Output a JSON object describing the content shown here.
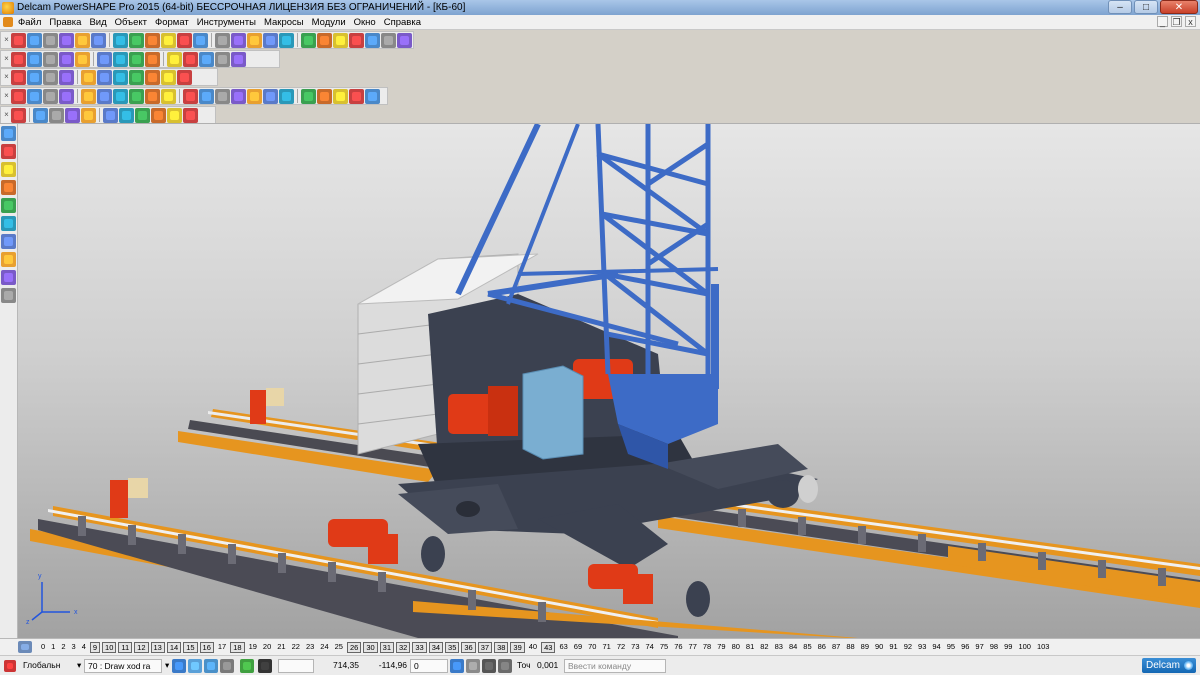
{
  "window": {
    "title": "Delcam PowerSHAPE Pro 2015 (64-bit) БЕССРОЧНАЯ ЛИЦЕНЗИЯ БЕЗ ОГРАНИЧЕНИЙ - [КБ-60]",
    "min": "–",
    "max": "□",
    "close": "✕"
  },
  "menu": [
    "Файл",
    "Правка",
    "Вид",
    "Объект",
    "Формат",
    "Инструменты",
    "Макросы",
    "Модули",
    "Окно",
    "Справка"
  ],
  "mdi": {
    "min": "_",
    "restore": "❐",
    "close": "x"
  },
  "levels": [
    "0",
    "1",
    "2",
    "3",
    "4",
    "9",
    "10",
    "11",
    "12",
    "13",
    "14",
    "15",
    "16",
    "17",
    "18",
    "19",
    "20",
    "21",
    "22",
    "23",
    "24",
    "25",
    "26",
    "30",
    "31",
    "32",
    "33",
    "34",
    "35",
    "36",
    "37",
    "38",
    "39",
    "40",
    "43",
    "63",
    "69",
    "70",
    "71",
    "72",
    "73",
    "74",
    "75",
    "76",
    "77",
    "78",
    "79",
    "80",
    "81",
    "82",
    "83",
    "84",
    "85",
    "86",
    "87",
    "88",
    "89",
    "90",
    "91",
    "92",
    "93",
    "94",
    "95",
    "96",
    "97",
    "98",
    "99",
    "100",
    "103"
  ],
  "levels_active": [
    "9",
    "10",
    "11",
    "12",
    "13",
    "14",
    "15",
    "16",
    "18",
    "26",
    "30",
    "31",
    "32",
    "33",
    "34",
    "35",
    "36",
    "37",
    "38",
    "39",
    "43"
  ],
  "status": {
    "workplane": "Глобальн",
    "level": "70 : Draw xod ra",
    "x": "714,35",
    "y": "-114,96",
    "z": "0",
    "tol_label": "Точ",
    "tol": "0,001",
    "command_placeholder": "Ввести команду",
    "brand": "Delcam"
  },
  "axes": {
    "x": "x",
    "y": "y",
    "z": "z"
  },
  "colors": {
    "crane_blue": "#3d6bc6",
    "steel": "#3b4150",
    "motor_red": "#e03a17",
    "rail_orange": "#e6951f",
    "counterweight": "#dcdcdc",
    "box_blue": "#7aaed1"
  }
}
